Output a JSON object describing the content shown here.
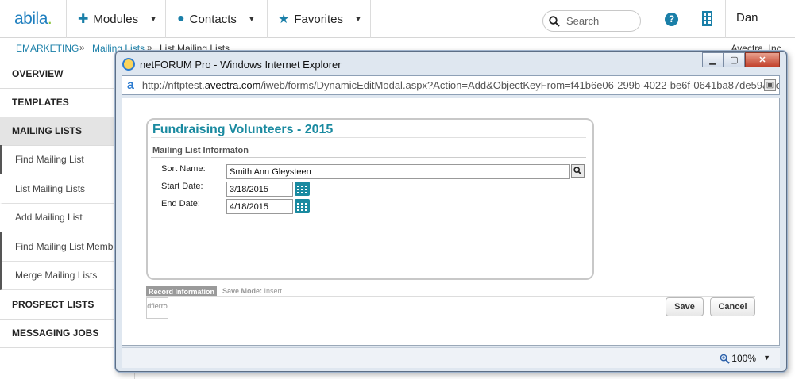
{
  "nav": {
    "logo": "abila",
    "modules": "Modules",
    "contacts": "Contacts",
    "favorites": "Favorites",
    "search_placeholder": "Search",
    "help": "?",
    "user": "Dan"
  },
  "breadcrumb": {
    "items": [
      "EMARKETING",
      "Mailing Lists",
      "List Mailing Lists"
    ],
    "separator": "»",
    "org": "Avectra, Inc."
  },
  "sidebar": {
    "overview": "OVERVIEW",
    "templates": "TEMPLATES",
    "mailing_lists": "MAILING LISTS",
    "sub_items": [
      "Find Mailing List",
      "List Mailing Lists",
      "Add Mailing List",
      "Find Mailing List Members",
      "Merge Mailing Lists"
    ],
    "prospect_lists": "PROSPECT LISTS",
    "messaging_jobs": "MESSAGING JOBS"
  },
  "ie_window": {
    "title": "netFORUM Pro - Windows Internet Explorer",
    "url_prefix": "http://nftptest.",
    "url_host": "avectra.com",
    "url_rest": "/iweb/forms/DynamicEditModal.aspx?Action=Add&ObjectKeyFrom=f41b6e06-299b-4022-be6f-0641ba87de59&FormKey",
    "zoom": "100%"
  },
  "form": {
    "title": "Fundraising Volunteers - 2015",
    "section": "Mailing List Informaton",
    "sort_name_label": "Sort Name:",
    "sort_name_value": "Smith Ann Gleysteen",
    "start_date_label": "Start Date:",
    "start_date_value": "3/18/2015",
    "end_date_label": "End Date:",
    "end_date_value": "4/18/2015",
    "record_tab": "Record Information",
    "save_mode_label": "Save Mode:",
    "save_mode_value": "Insert",
    "record_user": "dfierro",
    "save": "Save",
    "cancel": "Cancel"
  },
  "colors": {
    "accent": "#1a8aa0",
    "brand": "#1f7fbf"
  }
}
